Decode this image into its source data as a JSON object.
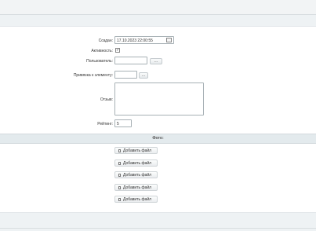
{
  "form": {
    "created_label": "Создан:",
    "created_value": "17.10.2023 22:00:55",
    "active_label": "Активность:",
    "active_checked": "✓",
    "user_label": "Пользователь:",
    "user_button": "...",
    "element_label": "Привязка к элементу:",
    "element_button": "...",
    "review_label": "Отзыв:",
    "rating_label": "Рейтинг:",
    "rating_value": "5"
  },
  "photos": {
    "header": "Фото:",
    "add_buttons": [
      "Добавить файл",
      "Добавить файл",
      "Добавить файл",
      "Добавить файл",
      "Добавить файл"
    ]
  },
  "icons": [
    "calendar-icon",
    "checkbox-icon",
    "file-icon"
  ]
}
